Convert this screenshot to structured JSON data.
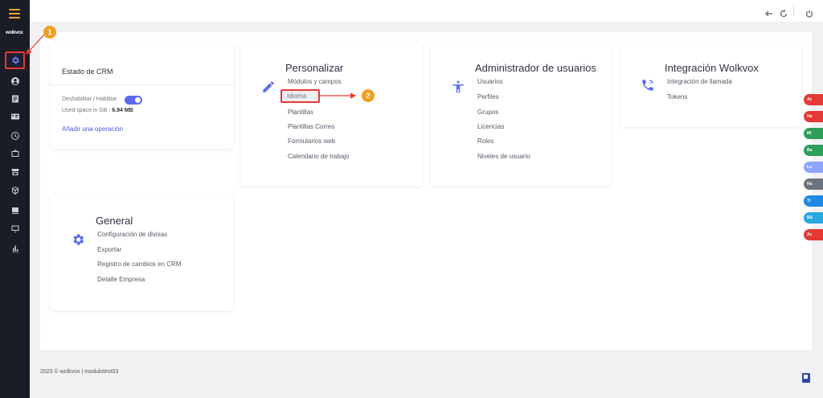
{
  "sidebar": {
    "logo": "wolkvox",
    "icons": [
      "gear-icon",
      "user-circle-icon",
      "list-icon",
      "id-card-icon",
      "clock-icon",
      "briefcase-icon",
      "store-icon",
      "box-icon",
      "inbox-icon",
      "presentation-icon",
      "bar-chart-icon"
    ]
  },
  "topbar": {
    "icons": [
      "back-arrow-icon",
      "refresh-icon",
      "power-icon"
    ]
  },
  "crm_state": {
    "title": "Estado de CRM",
    "toggle_label": "Deshabilitar / Habilitar",
    "space_label": "Used space in GB :",
    "space_value": "6.94 MB",
    "add_operation": "Añadir una operación"
  },
  "personalizar": {
    "title": "Personalizar",
    "links": [
      "Módulos y campos",
      "Idioma",
      "Plantillas",
      "Plantillas Correo",
      "Formularios web",
      "Calendario de trabajo"
    ]
  },
  "admin_usuarios": {
    "title": "Administrador de usuarios",
    "links": [
      "Usuarios",
      "Perfiles",
      "Grupos",
      "Licencias",
      "Roles",
      "Niveles de usuario"
    ]
  },
  "integracion": {
    "title": "Integración Wolkvox",
    "links": [
      "Integración de llamada",
      "Tokens"
    ]
  },
  "general": {
    "title": "General",
    "links": [
      "Configuración de divisas",
      "Exportar",
      "Registro de cambios en CRM",
      "Detalle Empresa"
    ]
  },
  "annotations": {
    "badge1": "1",
    "badge2": "2",
    "color": "#e53935"
  },
  "side_tabs": [
    {
      "label": "Ac",
      "color": "#e53935"
    },
    {
      "label": "Ha",
      "color": "#e53935"
    },
    {
      "label": "Mi",
      "color": "#2e9e5b"
    },
    {
      "label": "Ba",
      "color": "#2e9e5b"
    },
    {
      "label": "Lo",
      "color": "#8fa4ff"
    },
    {
      "label": "Ha",
      "color": "#6c757d"
    },
    {
      "label": "Tr",
      "color": "#1e88e5"
    },
    {
      "label": "BA",
      "color": "#29a8e0"
    },
    {
      "label": "Ac",
      "color": "#e53935"
    }
  ],
  "footer": {
    "text": "2023 © wolkvox | modulotest03"
  }
}
